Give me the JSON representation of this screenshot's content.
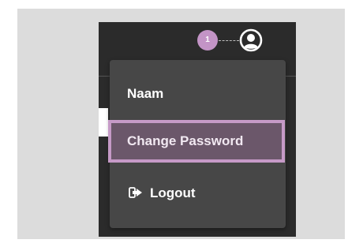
{
  "header": {
    "step_badge": "1"
  },
  "user_menu": {
    "items": [
      {
        "label": "Naam",
        "icon": null
      },
      {
        "label": "Change Password",
        "icon": null,
        "highlighted": true
      },
      {
        "label": "Logout",
        "icon": "logout-icon"
      }
    ]
  },
  "colors": {
    "highlight_border": "#c69ac7",
    "highlight_fill": "#6b576a",
    "menu_background": "#474747",
    "app_background": "#2b2b2b",
    "badge": "#c394c6"
  }
}
